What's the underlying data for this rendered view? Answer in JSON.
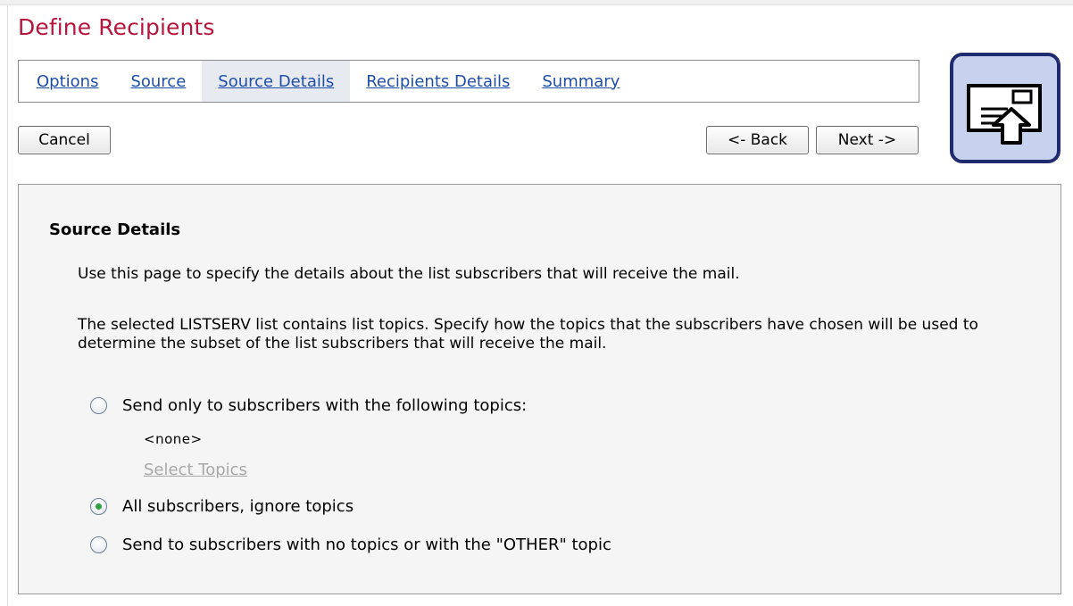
{
  "page": {
    "title": "Define Recipients"
  },
  "tabs": [
    {
      "label": "Options"
    },
    {
      "label": "Source"
    },
    {
      "label": "Source Details"
    },
    {
      "label": "Recipients Details"
    },
    {
      "label": "Summary"
    }
  ],
  "active_tab": "Source Details",
  "buttons": {
    "cancel": "Cancel",
    "back": "<- Back",
    "next": "Next ->"
  },
  "wizard_icon": "mail-document-upload-icon",
  "section": {
    "title": "Source Details",
    "intro": "Use this page to specify the details about the list subscribers that will receive the mail.",
    "explanation": "The selected LISTSERV list contains list topics. Specify how the topics that the subscribers have chosen will be used to determine the subset of the list subscribers that will receive the mail."
  },
  "options": {
    "only_topics": {
      "label": "Send only to subscribers with the following topics:",
      "selected": false
    },
    "topics_value": "<none>",
    "select_topics_link": "Select Topics",
    "all_subscribers": {
      "label": "All subscribers, ignore topics",
      "selected": true
    },
    "no_topics": {
      "label": "Send to subscribers with no topics or with the \"OTHER\" topic",
      "selected": false
    }
  },
  "colors": {
    "title": "#b5163c",
    "link": "#1f4ea8",
    "active_tab_bg": "#e7eaf1",
    "icon_border": "#202a6e",
    "icon_bg": "#c7d3ee",
    "radio_checked": "#2e9e3e"
  }
}
